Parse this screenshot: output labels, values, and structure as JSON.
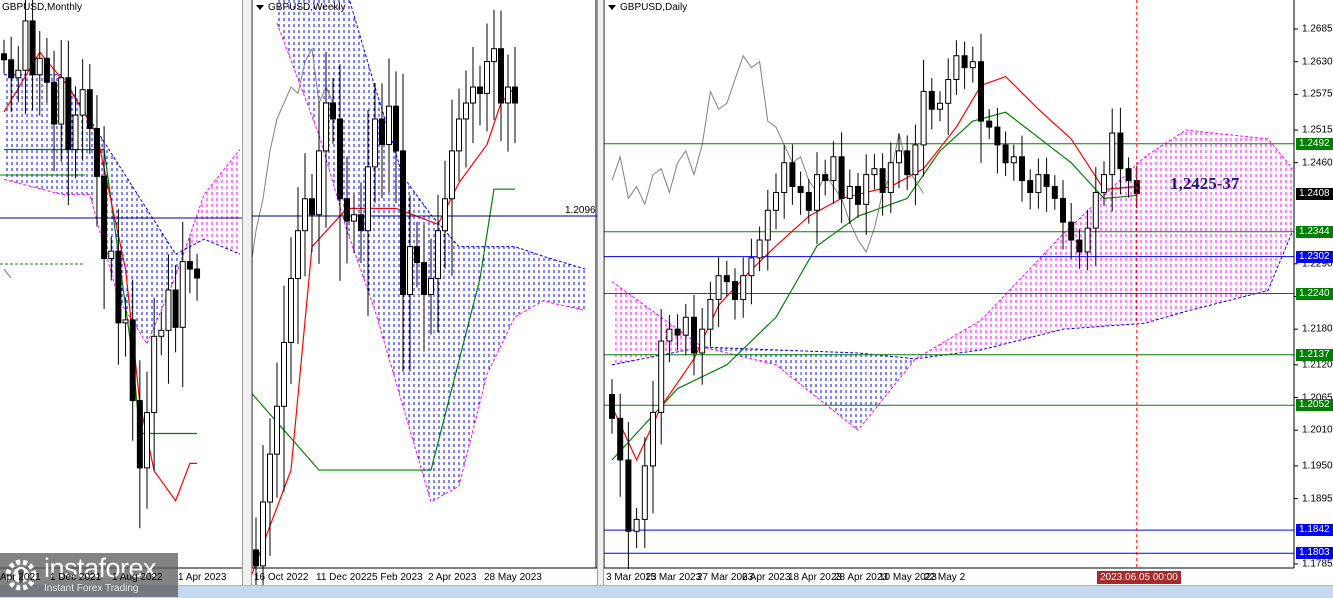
{
  "panels": {
    "monthly": {
      "title": "GBPUSD,Monthly",
      "dates": [
        "Apr 2021",
        "1 Dec 2021",
        "1 Aug 2022",
        "1 Apr 2023"
      ]
    },
    "weekly": {
      "title": "GBPUSD,Weekly",
      "dates": [
        "16 Oct 2022",
        "11 Dec 2022",
        "5 Feb 2023",
        "2 Apr 2023",
        "28 May 2023"
      ],
      "level_label": "1.2096"
    },
    "daily": {
      "title": "GBPUSD,Daily",
      "dates": [
        "3 Mar 2023",
        "15 Mar 2023",
        "27 Mar 2023",
        "6 Apr 2023",
        "18 Apr 2023",
        "28 Apr 2023",
        "10 May 2023",
        "22 May 2"
      ],
      "crosshair_time": "2023.06.05 00:00",
      "annotation": "1,2425-37"
    }
  },
  "price_ticks": [
    "1.2685",
    "1.2630",
    "1.2575",
    "1.2515",
    "1.2460",
    "1.2290",
    "1.2235",
    "1.2180",
    "1.2120",
    "1.2065",
    "1.2010",
    "1.1950",
    "1.1895",
    "1.1785"
  ],
  "price_levels": [
    {
      "label": "1.2492",
      "color": "#008000",
      "line": true
    },
    {
      "label": "1.2408",
      "color": "#000000",
      "line": false
    },
    {
      "label": "1.2344",
      "color": "#008000",
      "line": true
    },
    {
      "label": "1.2302",
      "color": "#0000ff",
      "line": true
    },
    {
      "label": "1.2240",
      "color": "#008000",
      "line": true
    },
    {
      "label": "1.2137",
      "color": "#008000",
      "line": true
    },
    {
      "label": "1.2052",
      "color": "#008000",
      "line": true
    },
    {
      "label": "1.1842",
      "color": "#0000ff",
      "line": true
    },
    {
      "label": "1.1803",
      "color": "#0000ff",
      "line": true
    }
  ],
  "logo": {
    "name": "instaforex",
    "tagline": "Instant Forex Trading"
  },
  "colors": {
    "bull_cloud": "#ff00ff",
    "bear_cloud": "#0000ff",
    "tenkan": "#ff0000",
    "kijun": "#008000",
    "chikou": "#808080",
    "crosshair": "#ff0000"
  },
  "chart_data": [
    {
      "type": "candlestick",
      "symbol": "GBPUSD",
      "timeframe": "Monthly",
      "ylim": [
        1.05,
        1.43
      ],
      "closes": [
        1.39,
        1.378,
        1.383,
        1.416,
        1.38,
        1.391,
        1.375,
        1.347,
        1.378,
        1.33,
        1.353,
        1.37,
        1.344,
        1.312,
        1.257,
        1.262,
        1.214,
        1.216,
        1.162,
        1.117,
        1.154,
        1.205,
        1.209,
        1.236,
        1.211,
        1.255,
        1.25,
        1.244
      ],
      "tenkan": [
        [
          0,
          1.355
        ],
        [
          5,
          1.395
        ],
        [
          9,
          1.372
        ],
        [
          13,
          1.34
        ],
        [
          17,
          1.25
        ],
        [
          19,
          1.16
        ],
        [
          21,
          1.115
        ],
        [
          24,
          1.095
        ],
        [
          26,
          1.12
        ]
      ],
      "kijun": [
        [
          0,
          1.33
        ],
        [
          14,
          1.33
        ],
        [
          16,
          1.26
        ],
        [
          18,
          1.19
        ],
        [
          19,
          1.14
        ],
        [
          27,
          1.14
        ]
      ],
      "cloud": [
        [
          0,
          1.31,
          1.38
        ],
        [
          8,
          1.3,
          1.38
        ],
        [
          12,
          1.3,
          1.35
        ],
        [
          16,
          1.23,
          1.32
        ],
        [
          20,
          1.2,
          1.29
        ],
        [
          24,
          1.245,
          1.26
        ],
        [
          28,
          1.3,
          1.27
        ],
        [
          33,
          1.33,
          1.26
        ]
      ]
    },
    {
      "type": "candlestick",
      "symbol": "GBPUSD",
      "timeframe": "Weekly",
      "reference_level": 1.2096,
      "closes": [
        1.105,
        1.1,
        1.12,
        1.135,
        1.15,
        1.17,
        1.19,
        1.205,
        1.215,
        1.21,
        1.23,
        1.245,
        1.24,
        1.215,
        1.208,
        1.21,
        1.205,
        1.225,
        1.24,
        1.232,
        1.244,
        1.23,
        1.185,
        1.2,
        1.195,
        1.185,
        1.19,
        1.205,
        1.215,
        1.23,
        1.24,
        1.245,
        1.25,
        1.248,
        1.258,
        1.262,
        1.245,
        1.25,
        1.245
      ],
      "tenkan": [
        [
          0,
          1.095
        ],
        [
          6,
          1.13
        ],
        [
          9,
          1.2
        ],
        [
          14,
          1.212
        ],
        [
          17,
          1.212
        ],
        [
          21,
          1.212
        ],
        [
          27,
          1.207
        ],
        [
          30,
          1.22
        ],
        [
          34,
          1.232
        ],
        [
          36,
          1.245
        ],
        [
          38,
          1.25
        ]
      ],
      "kijun": [
        [
          0,
          1.155
        ],
        [
          8,
          1.135
        ],
        [
          10,
          1.13
        ],
        [
          26,
          1.13
        ],
        [
          33,
          1.19
        ],
        [
          35,
          1.218
        ],
        [
          38,
          1.218
        ]
      ],
      "cloud": [
        [
          4,
          1.27,
          1.29
        ],
        [
          10,
          1.235,
          1.29
        ],
        [
          14,
          1.205,
          1.28
        ],
        [
          18,
          1.18,
          1.25
        ],
        [
          22,
          1.15,
          1.222
        ],
        [
          26,
          1.12,
          1.21
        ],
        [
          30,
          1.125,
          1.2
        ],
        [
          34,
          1.16,
          1.2
        ],
        [
          38,
          1.178,
          1.2
        ],
        [
          42,
          1.183,
          1.197
        ],
        [
          48,
          1.18,
          1.193
        ]
      ]
    },
    {
      "type": "candlestick",
      "symbol": "GBPUSD",
      "timeframe": "Daily",
      "ylim": [
        1.1785,
        1.2685
      ],
      "closes": [
        1.203,
        1.196,
        1.184,
        1.186,
        1.195,
        1.204,
        1.216,
        1.218,
        1.217,
        1.22,
        1.214,
        1.218,
        1.223,
        1.227,
        1.226,
        1.223,
        1.227,
        1.23,
        1.233,
        1.238,
        1.241,
        1.246,
        1.242,
        1.241,
        1.238,
        1.244,
        1.243,
        1.247,
        1.24,
        1.242,
        1.239,
        1.244,
        1.245,
        1.241,
        1.246,
        1.248,
        1.244,
        1.249,
        1.258,
        1.255,
        1.256,
        1.26,
        1.264,
        1.262,
        1.263,
        1.253,
        1.252,
        1.249,
        1.246,
        1.247,
        1.243,
        1.241,
        1.244,
        1.242,
        1.24,
        1.236,
        1.233,
        1.231,
        1.235,
        1.241,
        1.244,
        1.251,
        1.245,
        1.243,
        1.2408
      ],
      "tenkan": [
        [
          0,
          1.205
        ],
        [
          3,
          1.196
        ],
        [
          6,
          1.205
        ],
        [
          10,
          1.213
        ],
        [
          13,
          1.222
        ],
        [
          17,
          1.228
        ],
        [
          20,
          1.232
        ],
        [
          24,
          1.237
        ],
        [
          28,
          1.24
        ],
        [
          34,
          1.242
        ],
        [
          38,
          1.245
        ],
        [
          42,
          1.252
        ],
        [
          45,
          1.259
        ],
        [
          48,
          1.2605
        ],
        [
          52,
          1.255
        ],
        [
          56,
          1.25
        ],
        [
          60,
          1.2415
        ],
        [
          64,
          1.242
        ]
      ],
      "kijun": [
        [
          0,
          1.196
        ],
        [
          8,
          1.208
        ],
        [
          14,
          1.212
        ],
        [
          20,
          1.22
        ],
        [
          25,
          1.232
        ],
        [
          30,
          1.237
        ],
        [
          36,
          1.24
        ],
        [
          40,
          1.248
        ],
        [
          44,
          1.253
        ],
        [
          48,
          1.2545
        ],
        [
          56,
          1.246
        ],
        [
          60,
          1.24
        ],
        [
          64,
          1.2405
        ]
      ],
      "cloud": [
        [
          0,
          1.226,
          1.212
        ],
        [
          11,
          1.215,
          1.215
        ],
        [
          20,
          1.212,
          1.2145
        ],
        [
          30,
          1.201,
          1.214
        ],
        [
          37,
          1.213,
          1.213
        ],
        [
          45,
          1.2195,
          1.2145
        ],
        [
          55,
          1.234,
          1.218
        ],
        [
          65,
          1.247,
          1.219
        ],
        [
          70,
          1.2515,
          1.221
        ],
        [
          80,
          1.25,
          1.2245
        ],
        [
          83,
          1.245,
          1.2345
        ]
      ]
    }
  ]
}
